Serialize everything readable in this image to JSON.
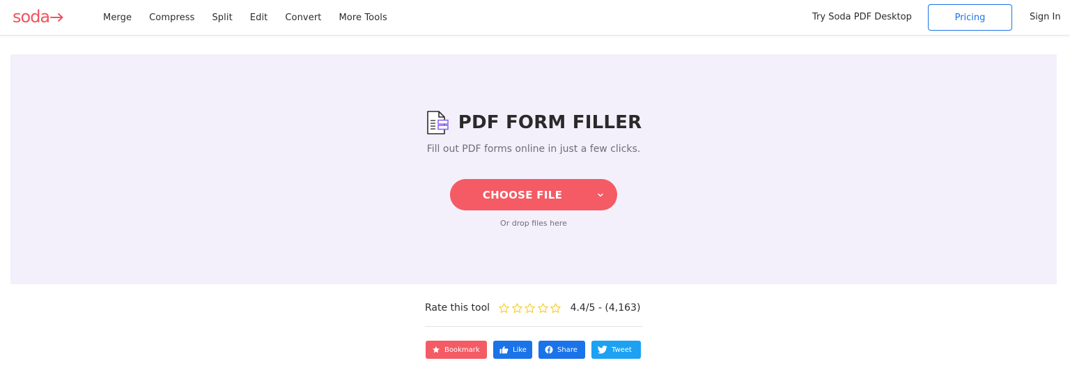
{
  "header": {
    "logo": "soda",
    "nav": [
      "Merge",
      "Compress",
      "Split",
      "Edit",
      "Convert",
      "More Tools"
    ],
    "try_desktop": "Try Soda PDF Desktop",
    "pricing": "Pricing",
    "sign_in": "Sign In"
  },
  "hero": {
    "icon": "form-document-icon",
    "title": "PDF FORM FILLER",
    "subtitle": "Fill out PDF forms online in just a few clicks.",
    "choose_file": "CHOOSE FILE",
    "drop_hint": "Or drop files here"
  },
  "rating": {
    "label": "Rate this tool",
    "stars_total": 5,
    "score": "4.4/5 - (4,163)"
  },
  "share": {
    "bookmark": "Bookmark",
    "like": "Like",
    "share": "Share",
    "tweet": "Tweet"
  },
  "colors": {
    "brand": "#f0545f",
    "accent_blue": "#1a73e8",
    "hero_bg": "#f3f0fb",
    "twitter": "#1da1f2",
    "star": "#f5c518"
  }
}
